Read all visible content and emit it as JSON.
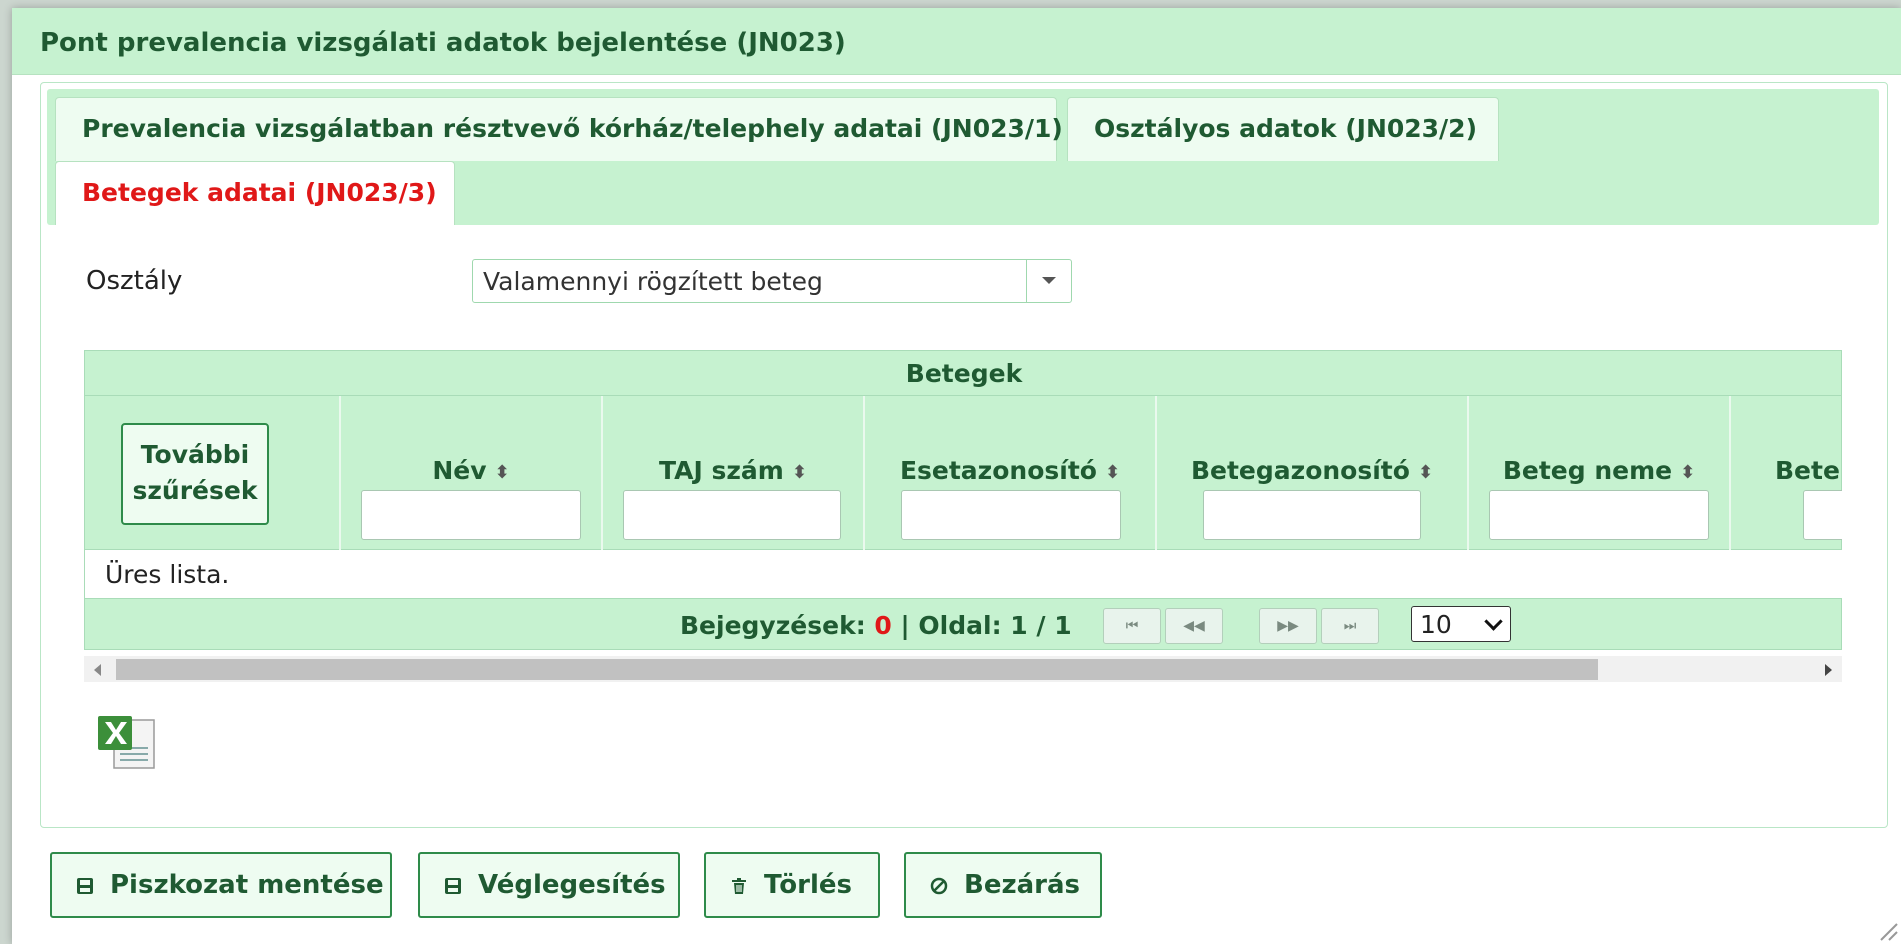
{
  "dialog": {
    "title": "Pont prevalencia vizsgálati adatok bejelentése (JN023)"
  },
  "tabs": [
    {
      "label": "Prevalencia vizsgálatban résztvevő kórház/telephely adatai (JN023/1)",
      "active": false
    },
    {
      "label": "Osztályos adatok (JN023/2)",
      "active": false
    },
    {
      "label": "Betegek adatai (JN023/3)",
      "active": true
    }
  ],
  "filter": {
    "label": "Osztály",
    "selected": "Valamennyi rögzített beteg"
  },
  "table": {
    "caption": "Betegek",
    "filter_button": "További szűrések",
    "columns": [
      "Név",
      "TAJ szám",
      "Esetazonosító",
      "Betegazonosító",
      "Beteg neme",
      "Bete"
    ],
    "empty_text": "Üres lista."
  },
  "pager": {
    "entries_label": "Bejegyzések:",
    "entries_count": "0",
    "page_label": "Oldal: 1 / 1",
    "page_size": "10"
  },
  "actions": {
    "save_draft": "Piszkozat mentése",
    "finalize": "Véglegesítés",
    "delete": "Törlés",
    "close": "Bezárás"
  },
  "colors": {
    "header_bg": "#c6f2d0",
    "accent_green": "#2e8b4a",
    "active_tab": "#e01818"
  }
}
